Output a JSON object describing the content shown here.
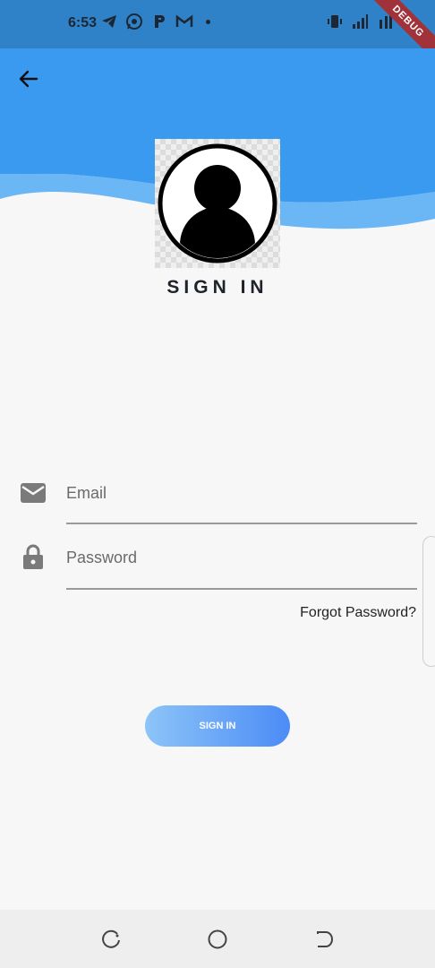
{
  "status_bar": {
    "time": "6:53",
    "left_icons": [
      "telegram-icon",
      "whatsapp-icon",
      "paytm-icon",
      "gmail-icon"
    ],
    "right_icons": [
      "vibrate-icon",
      "signal-icon",
      "network-4g-icon",
      "battery-icon"
    ],
    "debug_banner": "DEBUG"
  },
  "header": {
    "back_icon": "arrow-back-icon",
    "colors": {
      "primary": "#3a9af0",
      "wave": "#6bb6f5",
      "status": "#2f82c8"
    }
  },
  "avatar": {
    "icon": "account-circle-icon"
  },
  "title": "SIGN IN",
  "form": {
    "email": {
      "placeholder": "Email",
      "value": "",
      "icon": "mail-icon"
    },
    "password": {
      "placeholder": "Password",
      "value": "",
      "icon": "lock-icon"
    },
    "forgot_label": "Forgot Password?",
    "submit_label": "SIGN IN",
    "button_colors": [
      "#8dc4f8",
      "#4b8cf6"
    ]
  },
  "nav_bar": {
    "buttons": [
      "recents-icon",
      "home-icon",
      "back-icon"
    ]
  }
}
